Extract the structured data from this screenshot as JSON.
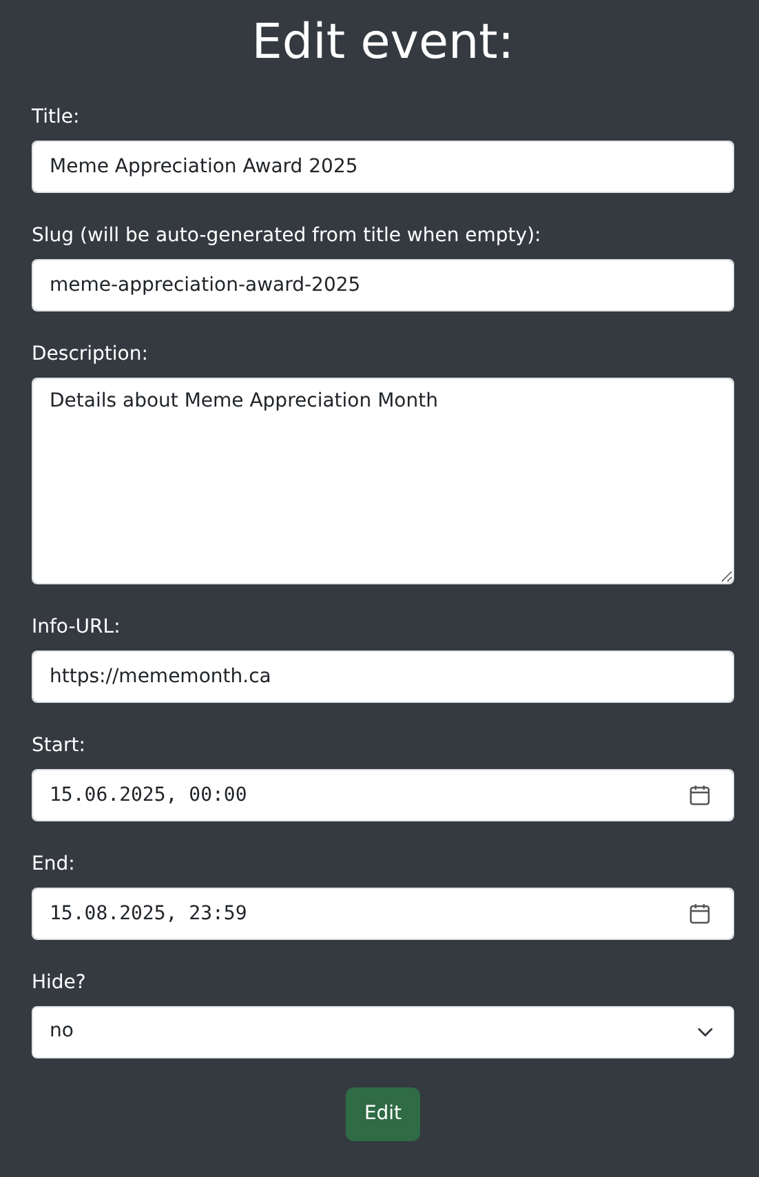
{
  "heading": "Edit event:",
  "fields": [
    {
      "kind": "text",
      "label": "Title:",
      "value": "Meme Appreciation Award 2025"
    },
    {
      "kind": "text",
      "label": "Slug (will be auto-generated from title when empty):",
      "value": "meme-appreciation-award-2025"
    },
    {
      "kind": "textarea",
      "label": "Description:",
      "value": "Details about Meme Appreciation Month"
    },
    {
      "kind": "text",
      "label": "Info-URL:",
      "value": "https://mememonth.ca"
    },
    {
      "kind": "datetime",
      "label": "Start:",
      "value": "15.06.2025, 00:00"
    },
    {
      "kind": "datetime",
      "label": "End:",
      "value": "15.08.2025, 23:59"
    },
    {
      "kind": "select",
      "label": "Hide?",
      "value": "no"
    }
  ],
  "submit": "Edit"
}
